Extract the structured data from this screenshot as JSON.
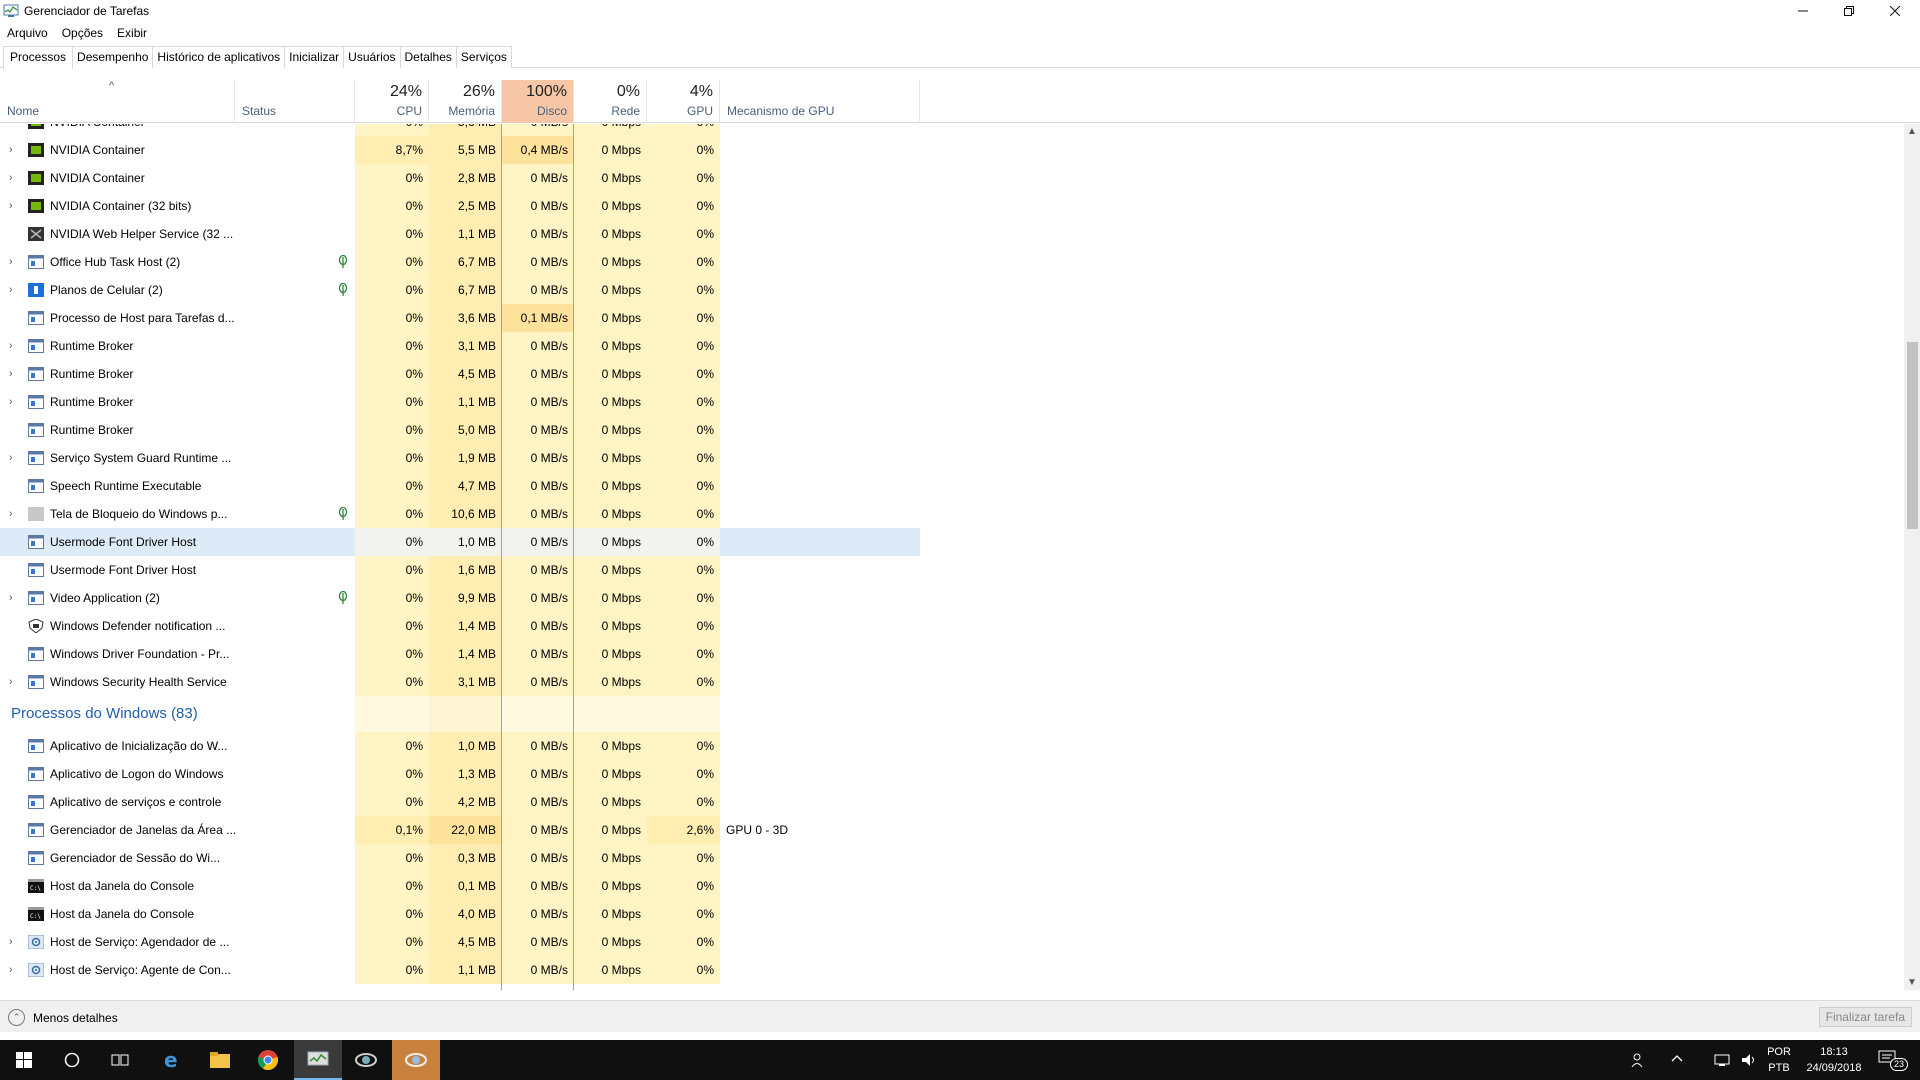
{
  "window": {
    "title": "Gerenciador de Tarefas",
    "minimize_icon": "minimize-icon",
    "maximize_icon": "restore-icon",
    "close_icon": "close-icon"
  },
  "menu": [
    "Arquivo",
    "Opções",
    "Exibir"
  ],
  "tabs": [
    "Processos",
    "Desempenho",
    "Histórico de aplicativos",
    "Inicializar",
    "Usuários",
    "Detalhes",
    "Serviços"
  ],
  "active_tab": "Processos",
  "columns": {
    "name": "Nome",
    "status": "Status",
    "cpu": {
      "pct": "24%",
      "label": "CPU"
    },
    "memory": {
      "pct": "26%",
      "label": "Memória"
    },
    "disk": {
      "pct": "100%",
      "label": "Disco"
    },
    "network": {
      "pct": "0%",
      "label": "Rede"
    },
    "gpu": {
      "pct": "4%",
      "label": "GPU"
    },
    "gpu_engine": "Mecanismo de GPU"
  },
  "partial_row": {
    "cpu": "0%",
    "memory": "5,6 MB",
    "disk": "0 MB/s",
    "network": "0 Mbps",
    "gpu": "0%",
    "name": "NVIDIA Container"
  },
  "processes": [
    {
      "name": "NVIDIA Container",
      "expand": true,
      "icon": "nvidia-icon",
      "leaf": false,
      "cpu": "8,7%",
      "memory": "5,5 MB",
      "disk": "0,4 MB/s",
      "network": "0 Mbps",
      "gpu": "0%",
      "gpu_engine": "",
      "hi_cpu": true,
      "hi_disk": true
    },
    {
      "name": "NVIDIA Container",
      "expand": true,
      "icon": "nvidia-icon",
      "leaf": false,
      "cpu": "0%",
      "memory": "2,8 MB",
      "disk": "0 MB/s",
      "network": "0 Mbps",
      "gpu": "0%",
      "gpu_engine": ""
    },
    {
      "name": "NVIDIA Container (32 bits)",
      "expand": true,
      "icon": "nvidia-icon",
      "leaf": false,
      "cpu": "0%",
      "memory": "2,5 MB",
      "disk": "0 MB/s",
      "network": "0 Mbps",
      "gpu": "0%",
      "gpu_engine": ""
    },
    {
      "name": "NVIDIA Web Helper Service (32 ...",
      "expand": false,
      "icon": "nvidia-web-icon",
      "leaf": false,
      "cpu": "0%",
      "memory": "1,1 MB",
      "disk": "0 MB/s",
      "network": "0 Mbps",
      "gpu": "0%",
      "gpu_engine": ""
    },
    {
      "name": "Office Hub Task Host (2)",
      "expand": true,
      "icon": "app-window-icon",
      "leaf": true,
      "cpu": "0%",
      "memory": "6,7 MB",
      "disk": "0 MB/s",
      "network": "0 Mbps",
      "gpu": "0%",
      "gpu_engine": ""
    },
    {
      "name": "Planos de Celular (2)",
      "expand": true,
      "icon": "mobile-plans-icon",
      "leaf": true,
      "cpu": "0%",
      "memory": "6,7 MB",
      "disk": "0 MB/s",
      "network": "0 Mbps",
      "gpu": "0%",
      "gpu_engine": ""
    },
    {
      "name": "Processo de Host para Tarefas d...",
      "expand": false,
      "icon": "app-window-icon",
      "leaf": false,
      "cpu": "0%",
      "memory": "3,6 MB",
      "disk": "0,1 MB/s",
      "network": "0 Mbps",
      "gpu": "0%",
      "gpu_engine": "",
      "hi_disk": true
    },
    {
      "name": "Runtime Broker",
      "expand": true,
      "icon": "app-window-icon",
      "leaf": false,
      "cpu": "0%",
      "memory": "3,1 MB",
      "disk": "0 MB/s",
      "network": "0 Mbps",
      "gpu": "0%",
      "gpu_engine": ""
    },
    {
      "name": "Runtime Broker",
      "expand": true,
      "icon": "app-window-icon",
      "leaf": false,
      "cpu": "0%",
      "memory": "4,5 MB",
      "disk": "0 MB/s",
      "network": "0 Mbps",
      "gpu": "0%",
      "gpu_engine": ""
    },
    {
      "name": "Runtime Broker",
      "expand": true,
      "icon": "app-window-icon",
      "leaf": false,
      "cpu": "0%",
      "memory": "1,1 MB",
      "disk": "0 MB/s",
      "network": "0 Mbps",
      "gpu": "0%",
      "gpu_engine": ""
    },
    {
      "name": "Runtime Broker",
      "expand": false,
      "icon": "app-window-icon",
      "leaf": false,
      "cpu": "0%",
      "memory": "5,0 MB",
      "disk": "0 MB/s",
      "network": "0 Mbps",
      "gpu": "0%",
      "gpu_engine": ""
    },
    {
      "name": "Serviço System Guard Runtime ...",
      "expand": true,
      "icon": "app-window-icon",
      "leaf": false,
      "cpu": "0%",
      "memory": "1,9 MB",
      "disk": "0 MB/s",
      "network": "0 Mbps",
      "gpu": "0%",
      "gpu_engine": ""
    },
    {
      "name": "Speech Runtime Executable",
      "expand": false,
      "icon": "app-window-icon",
      "leaf": false,
      "cpu": "0%",
      "memory": "4,7 MB",
      "disk": "0 MB/s",
      "network": "0 Mbps",
      "gpu": "0%",
      "gpu_engine": ""
    },
    {
      "name": "Tela de Bloqueio do Windows p...",
      "expand": true,
      "icon": "lock-screen-icon",
      "leaf": true,
      "cpu": "0%",
      "memory": "10,6 MB",
      "disk": "0 MB/s",
      "network": "0 Mbps",
      "gpu": "0%",
      "gpu_engine": ""
    },
    {
      "name": "Usermode Font Driver Host",
      "expand": false,
      "icon": "app-window-icon",
      "leaf": false,
      "cpu": "0%",
      "memory": "1,0 MB",
      "disk": "0 MB/s",
      "network": "0 Mbps",
      "gpu": "0%",
      "gpu_engine": "",
      "selected": true
    },
    {
      "name": "Usermode Font Driver Host",
      "expand": false,
      "icon": "app-window-icon",
      "leaf": false,
      "cpu": "0%",
      "memory": "1,6 MB",
      "disk": "0 MB/s",
      "network": "0 Mbps",
      "gpu": "0%",
      "gpu_engine": ""
    },
    {
      "name": "Video Application (2)",
      "expand": true,
      "icon": "app-window-icon",
      "leaf": true,
      "cpu": "0%",
      "memory": "9,9 MB",
      "disk": "0 MB/s",
      "network": "0 Mbps",
      "gpu": "0%",
      "gpu_engine": ""
    },
    {
      "name": "Windows Defender notification ...",
      "expand": false,
      "icon": "defender-shield-icon",
      "leaf": false,
      "cpu": "0%",
      "memory": "1,4 MB",
      "disk": "0 MB/s",
      "network": "0 Mbps",
      "gpu": "0%",
      "gpu_engine": ""
    },
    {
      "name": "Windows Driver Foundation - Pr...",
      "expand": false,
      "icon": "app-window-icon",
      "leaf": false,
      "cpu": "0%",
      "memory": "1,4 MB",
      "disk": "0 MB/s",
      "network": "0 Mbps",
      "gpu": "0%",
      "gpu_engine": ""
    },
    {
      "name": "Windows Security Health Service",
      "expand": true,
      "icon": "app-window-icon",
      "leaf": false,
      "cpu": "0%",
      "memory": "3,1 MB",
      "disk": "0 MB/s",
      "network": "0 Mbps",
      "gpu": "0%",
      "gpu_engine": ""
    }
  ],
  "group": {
    "title": "Processos do Windows (83)"
  },
  "windows_processes": [
    {
      "name": "Aplicativo de Inicialização do W...",
      "expand": false,
      "icon": "app-window-icon",
      "cpu": "0%",
      "memory": "1,0 MB",
      "disk": "0 MB/s",
      "network": "0 Mbps",
      "gpu": "0%",
      "gpu_engine": ""
    },
    {
      "name": "Aplicativo de Logon do Windows",
      "expand": false,
      "icon": "app-window-icon",
      "cpu": "0%",
      "memory": "1,3 MB",
      "disk": "0 MB/s",
      "network": "0 Mbps",
      "gpu": "0%",
      "gpu_engine": ""
    },
    {
      "name": "Aplicativo de serviços e controle",
      "expand": false,
      "icon": "app-window-icon",
      "cpu": "0%",
      "memory": "4,2 MB",
      "disk": "0 MB/s",
      "network": "0 Mbps",
      "gpu": "0%",
      "gpu_engine": ""
    },
    {
      "name": "Gerenciador de Janelas da Área ...",
      "expand": false,
      "icon": "app-window-icon",
      "cpu": "0,1%",
      "memory": "22,0 MB",
      "disk": "0 MB/s",
      "network": "0 Mbps",
      "gpu": "2,6%",
      "gpu_engine": "GPU 0 - 3D",
      "hi_cpu": true,
      "hi_mem": true,
      "hi_gpu": true
    },
    {
      "name": "Gerenciador de Sessão do Wi...",
      "expand": false,
      "icon": "app-window-icon",
      "cpu": "0%",
      "memory": "0,3 MB",
      "disk": "0 MB/s",
      "network": "0 Mbps",
      "gpu": "0%",
      "gpu_engine": ""
    },
    {
      "name": "Host da Janela do Console",
      "expand": false,
      "icon": "console-icon",
      "cpu": "0%",
      "memory": "0,1 MB",
      "disk": "0 MB/s",
      "network": "0 Mbps",
      "gpu": "0%",
      "gpu_engine": ""
    },
    {
      "name": "Host da Janela do Console",
      "expand": false,
      "icon": "console-icon",
      "cpu": "0%",
      "memory": "4,0 MB",
      "disk": "0 MB/s",
      "network": "0 Mbps",
      "gpu": "0%",
      "gpu_engine": ""
    },
    {
      "name": "Host de Serviço: Agendador de ...",
      "expand": true,
      "icon": "service-gear-icon",
      "cpu": "0%",
      "memory": "4,5 MB",
      "disk": "0 MB/s",
      "network": "0 Mbps",
      "gpu": "0%",
      "gpu_engine": ""
    },
    {
      "name": "Host de Serviço: Agente de Con...",
      "expand": true,
      "icon": "service-gear-icon",
      "cpu": "0%",
      "memory": "1,1 MB",
      "disk": "0 MB/s",
      "network": "0 Mbps",
      "gpu": "0%",
      "gpu_engine": ""
    }
  ],
  "footer": {
    "less_details": "Menos detalhes",
    "end_task": "Finalizar tarefa"
  },
  "taskbar": {
    "items": [
      "windows-start-icon",
      "cortana-search-icon",
      "task-view-icon",
      "edge-icon",
      "file-explorer-icon",
      "chrome-icon",
      "task-manager-icon",
      "app-icon-2",
      "app-icon-3"
    ],
    "lang_line1": "POR",
    "lang_line2": "PTB",
    "time": "18:13",
    "date": "24/09/2018",
    "notification_count": "23"
  },
  "colors": {
    "disk_header": "#f7c6a6",
    "cell_light": "#fff4c4",
    "cell_heavy": "#fce29a",
    "selection": "#ddebf8",
    "group_title": "#1f5fa8"
  }
}
